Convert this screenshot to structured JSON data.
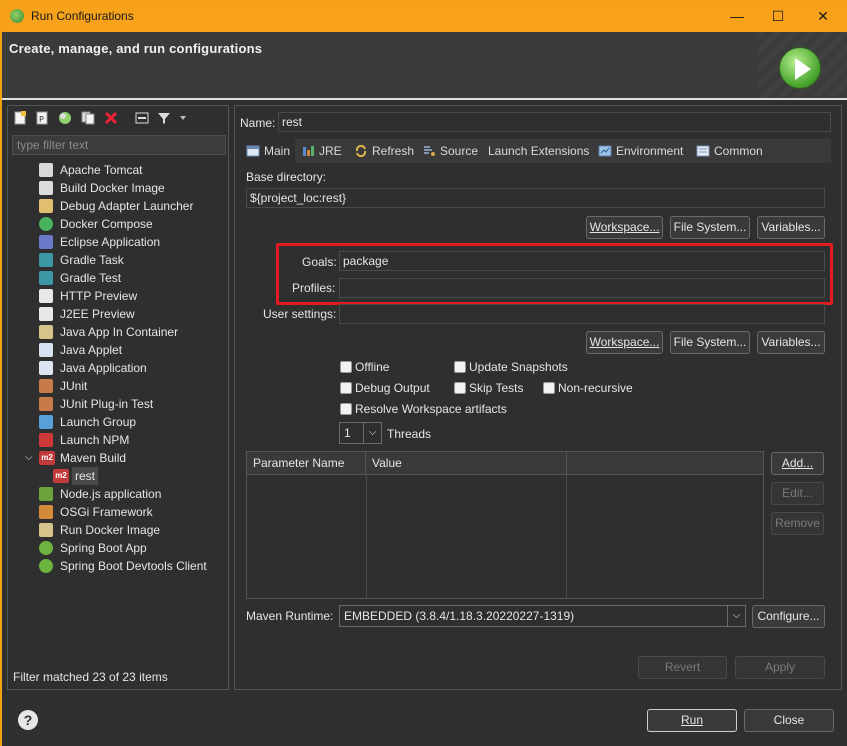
{
  "window": {
    "title": "Run Configurations",
    "minimize": "—",
    "maximize": "☐",
    "close": "✕"
  },
  "banner": {
    "heading": "Create, manage, and run configurations"
  },
  "left_panel": {
    "filter_placeholder": "type filter text",
    "tree": [
      {
        "label": "Apache Tomcat",
        "icon": "tomcat-icon"
      },
      {
        "label": "Build Docker Image",
        "icon": "docker-build-icon"
      },
      {
        "label": "Debug Adapter Launcher",
        "icon": "debug-adapter-icon"
      },
      {
        "label": "Docker Compose",
        "icon": "docker-compose-icon"
      },
      {
        "label": "Eclipse Application",
        "icon": "eclipse-icon"
      },
      {
        "label": "Gradle Task",
        "icon": "gradle-icon"
      },
      {
        "label": "Gradle Test",
        "icon": "gradle-icon"
      },
      {
        "label": "HTTP Preview",
        "icon": "http-icon"
      },
      {
        "label": "J2EE Preview",
        "icon": "j2ee-icon"
      },
      {
        "label": "Java App In Container",
        "icon": "java-container-icon"
      },
      {
        "label": "Java Applet",
        "icon": "applet-icon"
      },
      {
        "label": "Java Application",
        "icon": "java-app-icon"
      },
      {
        "label": "JUnit",
        "icon": "junit-icon"
      },
      {
        "label": "JUnit Plug-in Test",
        "icon": "junit-plugin-icon"
      },
      {
        "label": "Launch Group",
        "icon": "launch-group-icon"
      },
      {
        "label": "Launch NPM",
        "icon": "npm-icon"
      },
      {
        "label": "Maven Build",
        "icon": "maven-icon",
        "expanded": true
      },
      {
        "label": "rest",
        "icon": "maven-icon",
        "child": true,
        "selected": true
      },
      {
        "label": "Node.js application",
        "icon": "nodejs-icon"
      },
      {
        "label": "OSGi Framework",
        "icon": "osgi-icon"
      },
      {
        "label": "Run Docker Image",
        "icon": "docker-run-icon"
      },
      {
        "label": "Spring Boot App",
        "icon": "spring-boot-icon"
      },
      {
        "label": "Spring Boot Devtools Client",
        "icon": "spring-devtools-icon"
      }
    ],
    "filter_status": "Filter matched 23 of 23 items"
  },
  "config": {
    "name_label": "Name:",
    "name_value": "rest",
    "tabs": [
      "Main",
      "JRE",
      "Refresh",
      "Source",
      "Launch Extensions",
      "Environment",
      "Common"
    ],
    "base_dir_label": "Base directory:",
    "base_dir_value": "${project_loc:rest}",
    "workspace_btn": "Workspace...",
    "filesystem_btn": "File System...",
    "variables_btn": "Variables...",
    "goals_label": "Goals:",
    "goals_value": "package",
    "profiles_label": "Profiles:",
    "profiles_value": "",
    "user_settings_label": "User settings:",
    "user_settings_value": "",
    "offline": "Offline",
    "update_snapshots": "Update Snapshots",
    "debug_output": "Debug Output",
    "skip_tests": "Skip Tests",
    "non_recursive": "Non-recursive",
    "resolve_workspace": "Resolve Workspace artifacts",
    "threads_value": "1",
    "threads_label": "Threads",
    "param_header_name": "Parameter Name",
    "param_header_value": "Value",
    "add_btn": "Add...",
    "edit_btn": "Edit...",
    "remove_btn": "Remove",
    "maven_runtime_label": "Maven Runtime:",
    "maven_runtime_value": "EMBEDDED (3.8.4/1.18.3.20220227-1319)",
    "configure_btn": "Configure...",
    "revert_btn": "Revert",
    "apply_btn": "Apply"
  },
  "footer": {
    "help": "?",
    "run_btn": "Run",
    "close_btn": "Close"
  }
}
